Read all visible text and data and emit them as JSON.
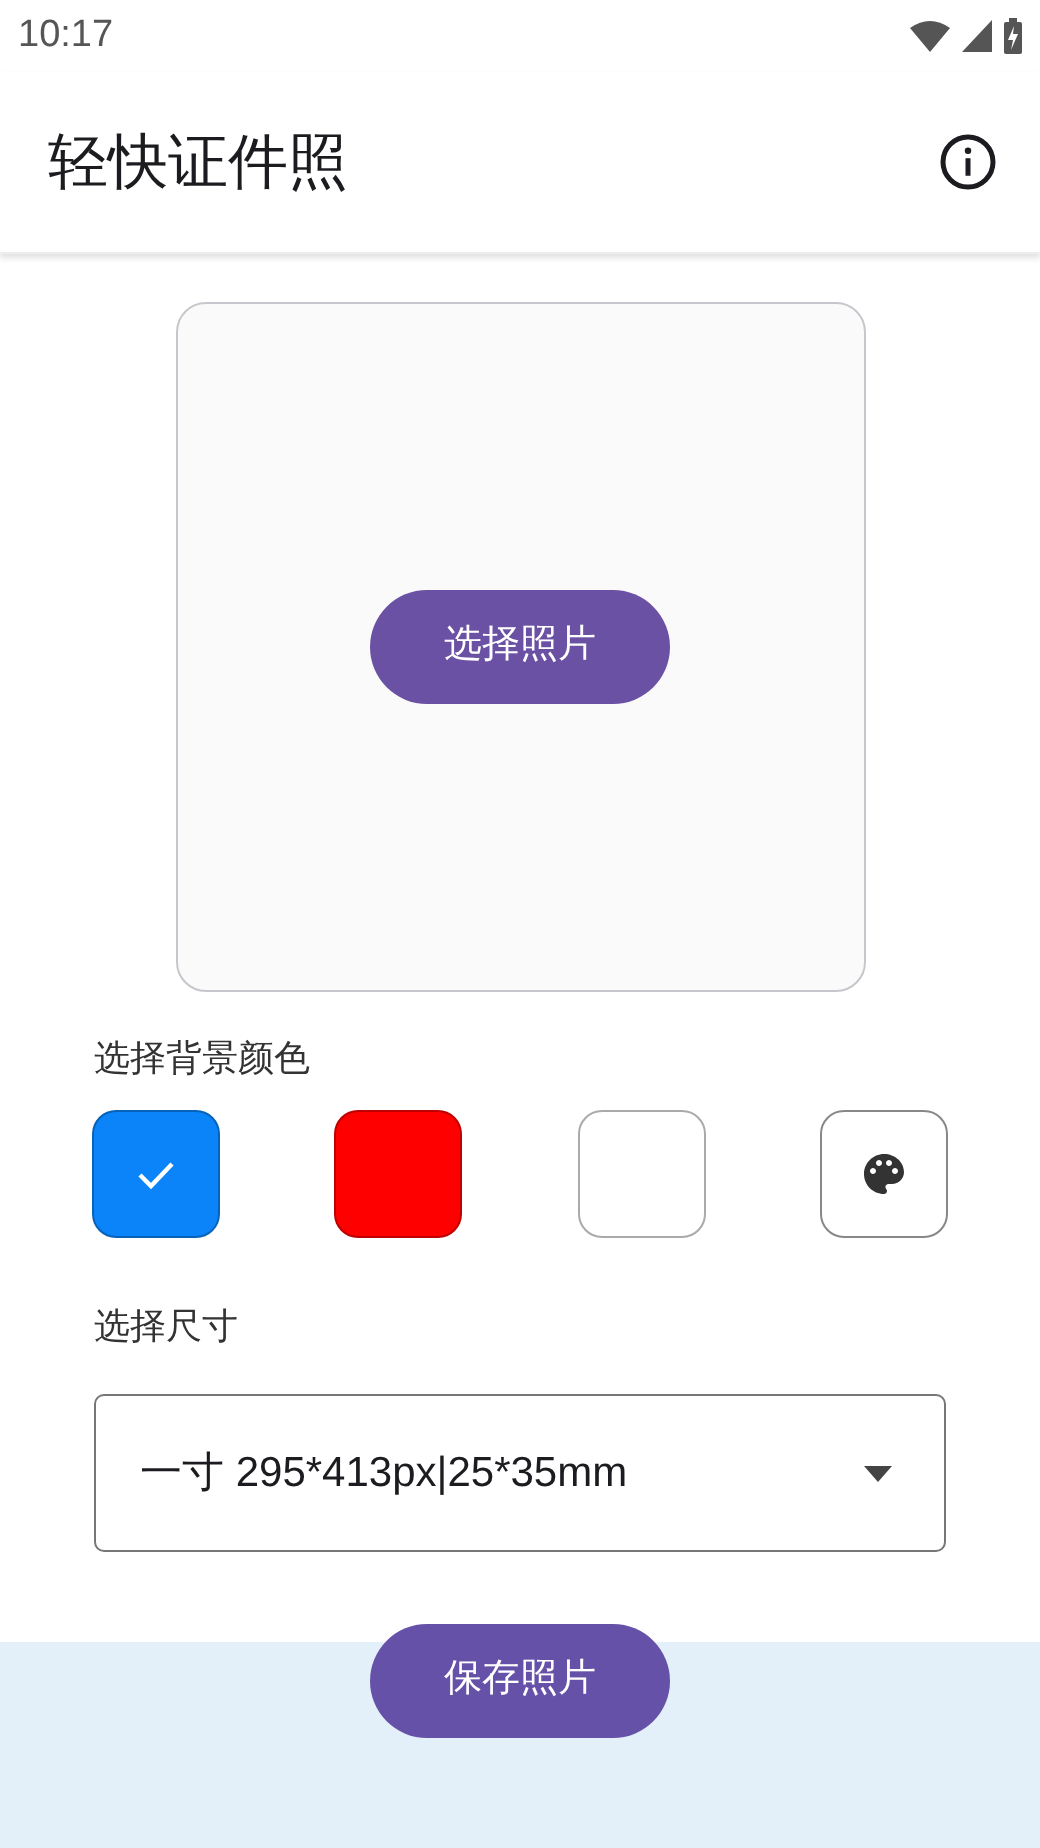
{
  "status_bar": {
    "time": "10:17"
  },
  "app_bar": {
    "title": "轻快证件照"
  },
  "photo_area": {
    "button": "选择照片"
  },
  "background_section": {
    "label": "选择背景颜色",
    "swatches": [
      {
        "kind": "color",
        "color": "#0a84f8",
        "selected": true
      },
      {
        "kind": "color",
        "color": "#ff0000",
        "selected": false
      },
      {
        "kind": "color",
        "color": "#ffffff",
        "selected": false
      },
      {
        "kind": "custom",
        "selected": false
      }
    ]
  },
  "size_section": {
    "label": "选择尺寸",
    "value": "一寸 295*413px|25*35mm"
  },
  "save_button": "保存照片"
}
